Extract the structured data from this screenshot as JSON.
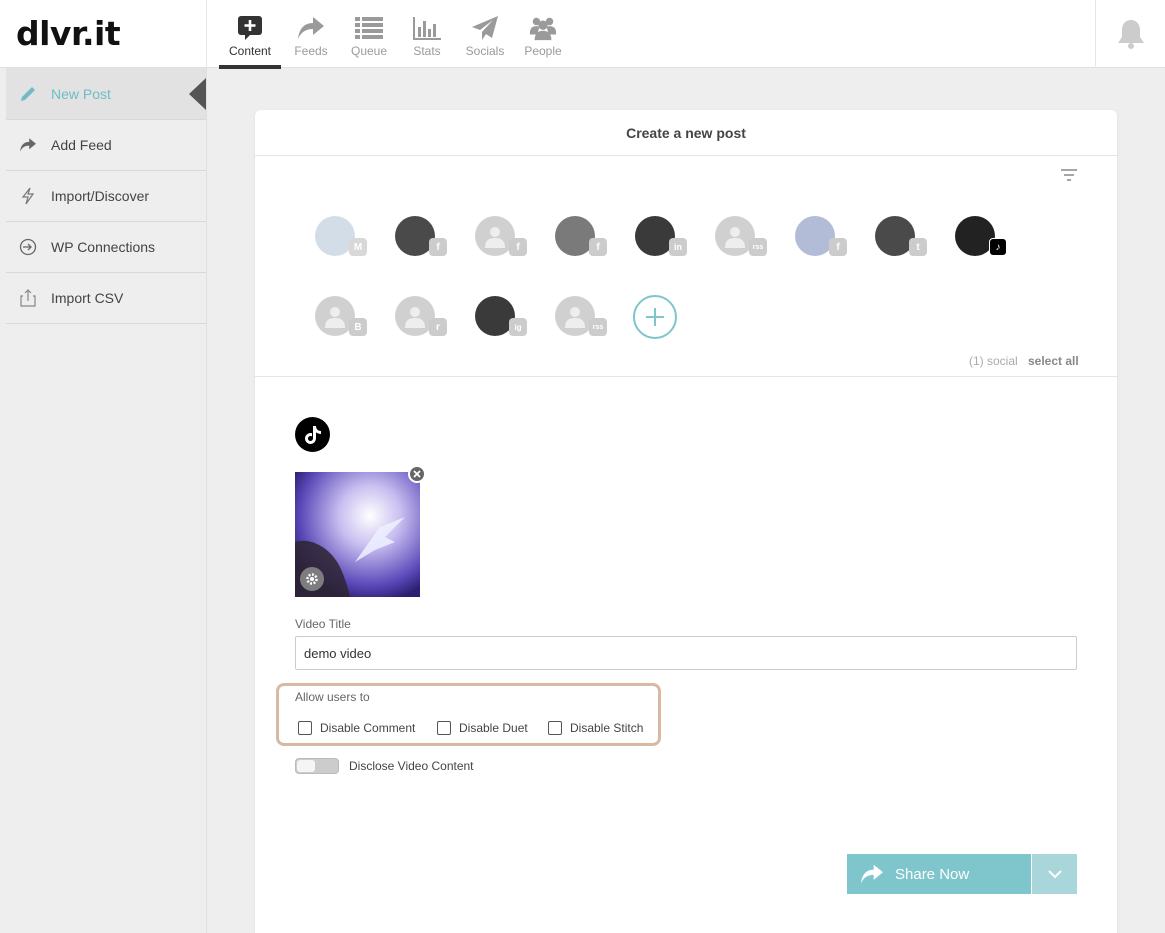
{
  "header": {
    "logo": "dlvr.it",
    "nav": [
      {
        "label": "Content",
        "icon": "content-plus-icon",
        "active": true
      },
      {
        "label": "Feeds",
        "icon": "share-arrow-icon"
      },
      {
        "label": "Queue",
        "icon": "list-icon"
      },
      {
        "label": "Stats",
        "icon": "bar-chart-icon"
      },
      {
        "label": "Socials",
        "icon": "paper-plane-icon"
      },
      {
        "label": "People",
        "icon": "people-icon"
      }
    ],
    "bell_icon": "bell-icon"
  },
  "sidebar": {
    "items": [
      {
        "label": "New Post",
        "icon": "pencil-icon",
        "active": true
      },
      {
        "label": "Add Feed",
        "icon": "share-arrow-icon"
      },
      {
        "label": "Import/Discover",
        "icon": "lightning-icon"
      },
      {
        "label": "WP Connections",
        "icon": "sign-in-icon"
      },
      {
        "label": "Import CSV",
        "icon": "upload-icon"
      }
    ]
  },
  "post": {
    "title": "Create a new post",
    "socials": [
      {
        "network": "mastodon",
        "badge": "M",
        "selected": false
      },
      {
        "network": "facebook",
        "badge": "f",
        "selected": false
      },
      {
        "network": "facebook",
        "badge": "f",
        "selected": false
      },
      {
        "network": "facebook",
        "badge": "f",
        "selected": false
      },
      {
        "network": "linkedin",
        "badge": "in",
        "selected": false
      },
      {
        "network": "rss",
        "badge": "rss",
        "selected": false
      },
      {
        "network": "facebook",
        "badge": "f",
        "selected": false
      },
      {
        "network": "twitter",
        "badge": "t",
        "selected": false
      },
      {
        "network": "tiktok",
        "badge": "♪",
        "selected": true
      },
      {
        "network": "blogger",
        "badge": "B",
        "selected": false
      },
      {
        "network": "reddit",
        "badge": "r",
        "selected": false
      },
      {
        "network": "instagram",
        "badge": "ig",
        "selected": false
      },
      {
        "network": "rss",
        "badge": "rss",
        "selected": false
      }
    ],
    "social_count": "(1) social",
    "select_all": "select all",
    "video_title_label": "Video Title",
    "video_title_value": "demo video",
    "allow_label": "Allow users to",
    "options": [
      {
        "label": "Disable Comment",
        "checked": false
      },
      {
        "label": "Disable Duet",
        "checked": false
      },
      {
        "label": "Disable Stitch",
        "checked": false
      }
    ],
    "disclose_label": "Disclose Video Content",
    "disclose_on": false,
    "share_label": "Share Now"
  },
  "colors": {
    "accent": "#7ec5cc",
    "highlight_border": "#d9b9a3"
  }
}
